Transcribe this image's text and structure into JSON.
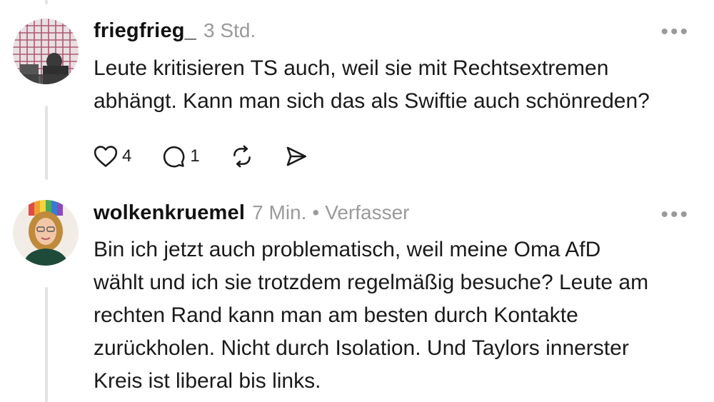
{
  "posts": [
    {
      "username": "friegfrieg_",
      "time": "3 Std.",
      "text_lines": [
        "Leute kritisieren TS auch, weil sie mit Rechtsextremen",
        "abhängt. Kann man sich das als Swiftie auch schönreden?"
      ],
      "likes": "4",
      "replies": "1"
    },
    {
      "username": "wolkenkruemel",
      "time": "7 Min.",
      "separator": "•",
      "badge": "Verfasser",
      "text_lines": [
        "Bin ich jetzt auch problematisch, weil meine Oma AfD",
        "wählt und ich sie trotzdem regelmäßig besuche? Leute am",
        "rechten Rand kann man am besten durch Kontakte",
        "zurückholen. Nicht durch Isolation. Und Taylors innerster",
        "Kreis ist liberal bis links."
      ]
    }
  ],
  "more_label": "•••",
  "icons": {
    "like": "heart-icon",
    "reply": "comment-icon",
    "repost": "repost-icon",
    "share": "send-icon"
  }
}
